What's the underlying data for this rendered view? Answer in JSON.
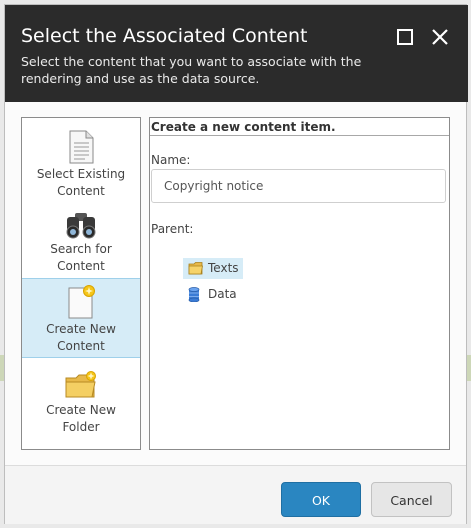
{
  "dialog": {
    "title": "Select the Associated Content",
    "subtitle": "Select the content that you want to associate with the rendering and use as the data source.",
    "maximize_icon": "maximize-icon",
    "close_icon": "close-icon"
  },
  "options": [
    {
      "label": "Select Existing Content",
      "icon": "document-icon",
      "selected": false
    },
    {
      "label": "Search for Content",
      "icon": "binoculars-icon",
      "selected": false
    },
    {
      "label": "Create New Content",
      "icon": "new-document-icon",
      "selected": true
    },
    {
      "label": "Create New Folder",
      "icon": "new-folder-icon",
      "selected": false
    }
  ],
  "form": {
    "heading": "Create a new content item.",
    "name_label": "Name:",
    "name_value": "Copyright notice",
    "parent_label": "Parent:",
    "tree": [
      {
        "label": "Texts",
        "icon": "folder-icon",
        "selected": true
      },
      {
        "label": "Data",
        "icon": "database-icon",
        "selected": false
      }
    ]
  },
  "footer": {
    "ok_label": "OK",
    "cancel_label": "Cancel"
  },
  "colors": {
    "title_bar": "#2b2b2b",
    "selection": "#d6ecf7",
    "primary_button": "#2a86c1"
  }
}
